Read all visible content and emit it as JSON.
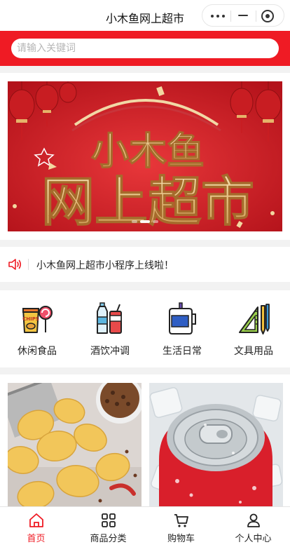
{
  "app": {
    "title": "小木鱼网上超市"
  },
  "capsule": {
    "more_icon": "more-dots-icon",
    "minimize_icon": "minimize-icon",
    "close_icon": "target-close-icon"
  },
  "search": {
    "placeholder": "请输入关键词",
    "value": ""
  },
  "banner": {
    "line1": "小木鱼",
    "line2": "网上超市",
    "slide_count": 3,
    "active_slide": 1
  },
  "notice": {
    "icon": "speaker-icon",
    "text": "小木鱼网上超市小程序上线啦！"
  },
  "categories": [
    {
      "label": "休闲食品",
      "icon": "snacks-icon"
    },
    {
      "label": "酒饮冲调",
      "icon": "drinks-icon"
    },
    {
      "label": "生活日常",
      "icon": "daily-life-icon"
    },
    {
      "label": "文具用品",
      "icon": "stationery-icon"
    }
  ],
  "products": [
    {
      "image": "potato-chips-image"
    },
    {
      "image": "soda-can-image"
    }
  ],
  "tabbar": {
    "items": [
      {
        "label": "首页",
        "icon": "home-icon",
        "active": true
      },
      {
        "label": "商品分类",
        "icon": "category-grid-icon",
        "active": false
      },
      {
        "label": "购物车",
        "icon": "cart-icon",
        "active": false
      },
      {
        "label": "个人中心",
        "icon": "user-icon",
        "active": false
      }
    ]
  },
  "colors": {
    "brand_red": "#ef1b24",
    "banner_red": "#d91e25",
    "gold": "#e9c98d"
  }
}
